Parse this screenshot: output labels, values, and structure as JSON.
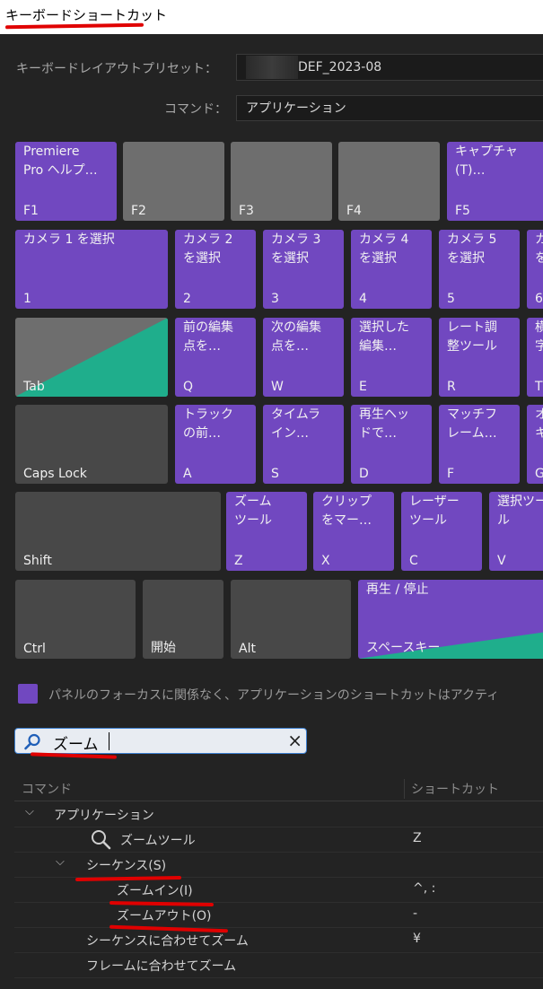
{
  "window": {
    "title": "キーボードショートカット"
  },
  "preset": {
    "label": "キーボードレイアウトプリセット：",
    "value": "DEF_2023-08"
  },
  "command": {
    "label": "コマンド：",
    "value": "アプリケーション"
  },
  "keyboard": {
    "rows": [
      [
        {
          "name": "Premiere\nPro ヘルプ…",
          "char": "F1",
          "style": "purple"
        },
        {
          "name": "",
          "char": "F2",
          "style": "gray"
        },
        {
          "name": "",
          "char": "F3",
          "style": "gray"
        },
        {
          "name": "",
          "char": "F4",
          "style": "gray"
        },
        {
          "name": "キャプチャ\n(T)…",
          "char": "F5",
          "style": "purple"
        }
      ],
      [
        {
          "name": "カメラ 1 を選択",
          "char": "1",
          "style": "purple"
        },
        {
          "name": "カメラ 2\nを選択",
          "char": "2",
          "style": "purple"
        },
        {
          "name": "カメラ 3\nを選択",
          "char": "3",
          "style": "purple"
        },
        {
          "name": "カメラ 4\nを選択",
          "char": "4",
          "style": "purple"
        },
        {
          "name": "カメラ 5\nを選択",
          "char": "5",
          "style": "purple"
        },
        {
          "name": "カ\nを",
          "char": "6",
          "style": "purple"
        }
      ],
      [
        {
          "name": "",
          "char": "Tab",
          "style": "split"
        },
        {
          "name": "前の編集\n点を…",
          "char": "Q",
          "style": "purple"
        },
        {
          "name": "次の編集\n点を…",
          "char": "W",
          "style": "purple"
        },
        {
          "name": "選択した\n編集…",
          "char": "E",
          "style": "purple"
        },
        {
          "name": "レート調\n整ツール",
          "char": "R",
          "style": "purple"
        },
        {
          "name": "横\n字",
          "char": "T",
          "style": "purple"
        }
      ],
      [
        {
          "name": "",
          "char": "Caps Lock",
          "style": "dark"
        },
        {
          "name": "トラック\nの前…",
          "char": "A",
          "style": "purple"
        },
        {
          "name": "タイムラ\nイン…",
          "char": "S",
          "style": "purple"
        },
        {
          "name": "再生ヘッ\nドで…",
          "char": "D",
          "style": "purple"
        },
        {
          "name": "マッチフ\nレーム…",
          "char": "F",
          "style": "purple"
        },
        {
          "name": "オ\nキ",
          "char": "G",
          "style": "purple"
        }
      ],
      [
        {
          "name": "",
          "char": "Shift",
          "style": "dark"
        },
        {
          "name": "ズーム\nツール",
          "char": "Z",
          "style": "purple"
        },
        {
          "name": "クリップ\nをマー…",
          "char": "X",
          "style": "purple"
        },
        {
          "name": "レーザー\nツール",
          "char": "C",
          "style": "purple"
        },
        {
          "name": "選択ツー\nル",
          "char": "V",
          "style": "purple"
        }
      ],
      [
        {
          "name": "",
          "char": "Ctrl",
          "style": "dark"
        },
        {
          "name": "",
          "char": "開始",
          "style": "dark"
        },
        {
          "name": "",
          "char": "Alt",
          "style": "dark"
        },
        {
          "name": "再生 / 停止",
          "char": "スペースキー",
          "style": "purple-split"
        }
      ]
    ]
  },
  "option": {
    "label": "パネルのフォーカスに関係なく、アプリケーションのショートカットはアクティ"
  },
  "search": {
    "value": "ズーム",
    "clear_icon": "×"
  },
  "table": {
    "headers": {
      "command": "コマンド",
      "shortcut": "ショートカット"
    },
    "rows": [
      {
        "name": "アプリケーション",
        "shortcut": "",
        "level": 0,
        "expander": "⌵"
      },
      {
        "name": "ズームツール",
        "shortcut": "Z",
        "level": 2,
        "icon": "magnifier-icon"
      },
      {
        "name": "シーケンス(S)",
        "shortcut": "",
        "level": 1,
        "expander": "⌵"
      },
      {
        "name": "ズームイン(I)",
        "shortcut": "^, :",
        "level": 2
      },
      {
        "name": "ズームアウト(O)",
        "shortcut": "-",
        "level": 2
      },
      {
        "name": "シーケンスに合わせてズーム",
        "shortcut": "¥",
        "level": 1
      },
      {
        "name": "フレームに合わせてズーム",
        "shortcut": "",
        "level": 1
      }
    ]
  },
  "colors": {
    "key_purple": "#7148c0",
    "key_gray": "#6e6e6e",
    "key_dark": "#484848",
    "assigned_green": "#1fae8c",
    "annotation_red": "#e00000"
  }
}
